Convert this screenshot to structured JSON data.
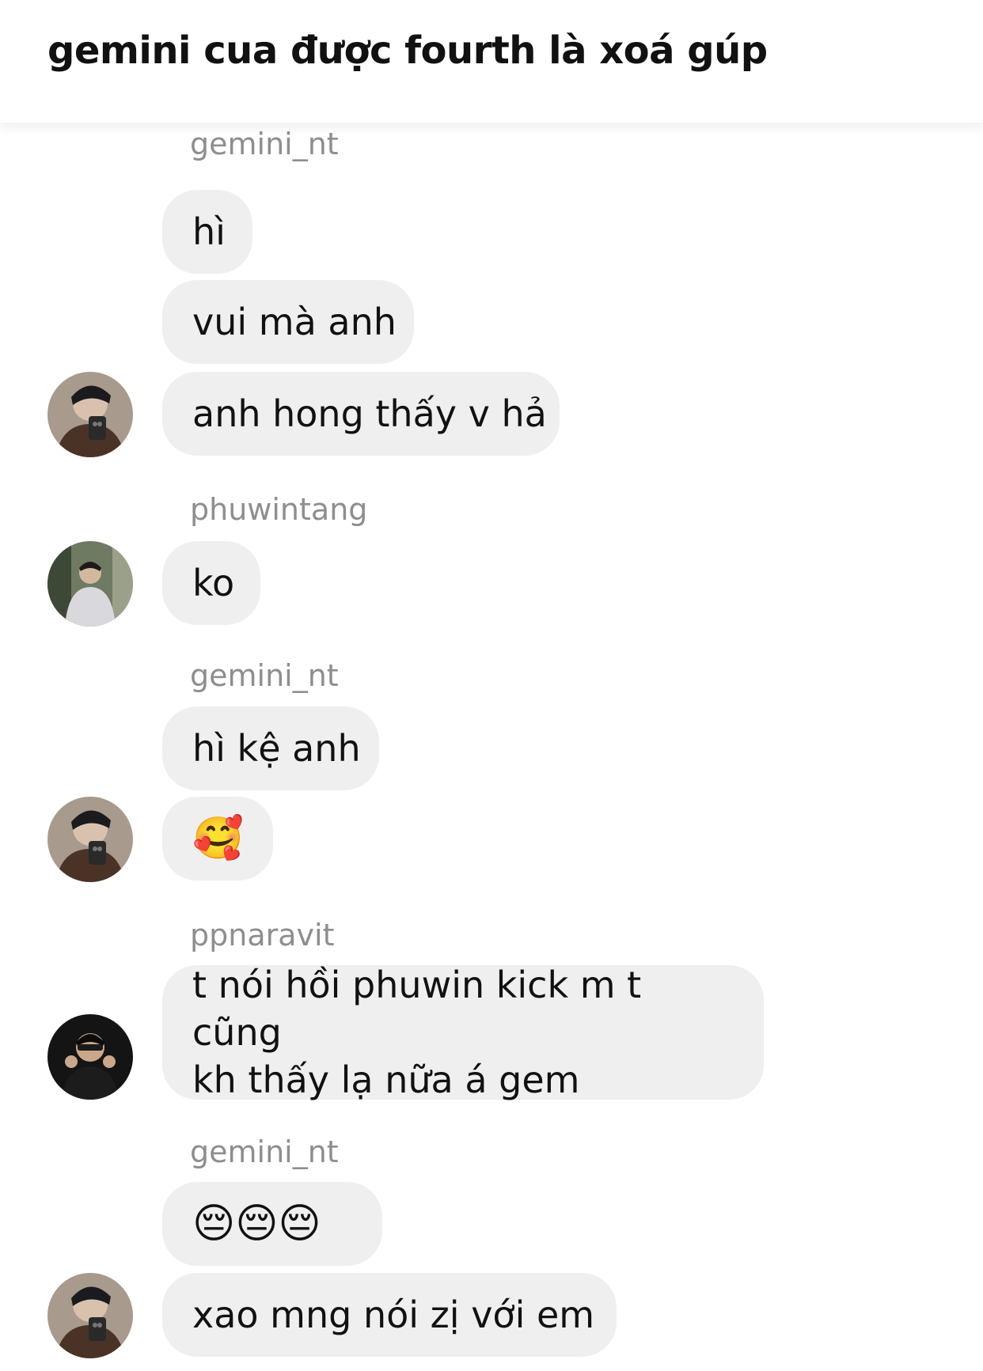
{
  "header": {
    "title": "gemini cua được fourth là xoá gúp"
  },
  "messages": [
    {
      "sender": "gemini_nt"
    },
    {
      "text": "hì"
    },
    {
      "text": "vui mà anh"
    },
    {
      "text": "anh hong thấy v hả"
    },
    {
      "sender": "phuwintang"
    },
    {
      "text": "ko"
    },
    {
      "sender": "gemini_nt"
    },
    {
      "text": "hì kệ anh"
    },
    {
      "text": "🥰"
    },
    {
      "sender": "ppnaravit"
    },
    {
      "line1": "t nói hồi phuwin kick m t cũng",
      "line2": "kh thấy lạ nữa á gem"
    },
    {
      "sender": "gemini_nt"
    },
    {
      "text": "😔😔😔"
    },
    {
      "text": "xao mng nói zị với em"
    }
  ],
  "colors": {
    "bubble_bg": "#efefef",
    "sender_text": "#8e8e8e",
    "background": "#ffffff"
  }
}
